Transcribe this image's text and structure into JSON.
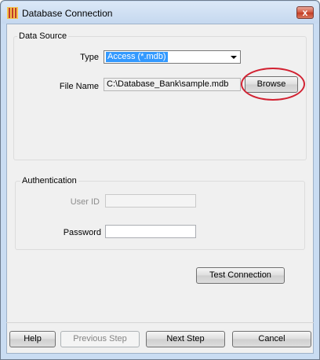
{
  "window": {
    "title": "Database Connection",
    "close_glyph": "x"
  },
  "data_source": {
    "group_label": "Data Source",
    "type_label": "Type",
    "type_value": "Access (*.mdb)",
    "file_name_label": "File Name",
    "file_name_value": "C:\\Database_Bank\\sample.mdb",
    "browse_label": "Browse"
  },
  "authentication": {
    "group_label": "Authentication",
    "user_id_label": "User ID",
    "user_id_value": "",
    "password_label": "Password",
    "password_value": ""
  },
  "test_connection_label": "Test Connection",
  "footer": {
    "help_label": "Help",
    "previous_label": "Previous Step",
    "next_label": "Next Step",
    "cancel_label": "Cancel"
  },
  "colors": {
    "selection": "#3399ff",
    "callout": "#d22232",
    "close_button": "#c33b22"
  }
}
